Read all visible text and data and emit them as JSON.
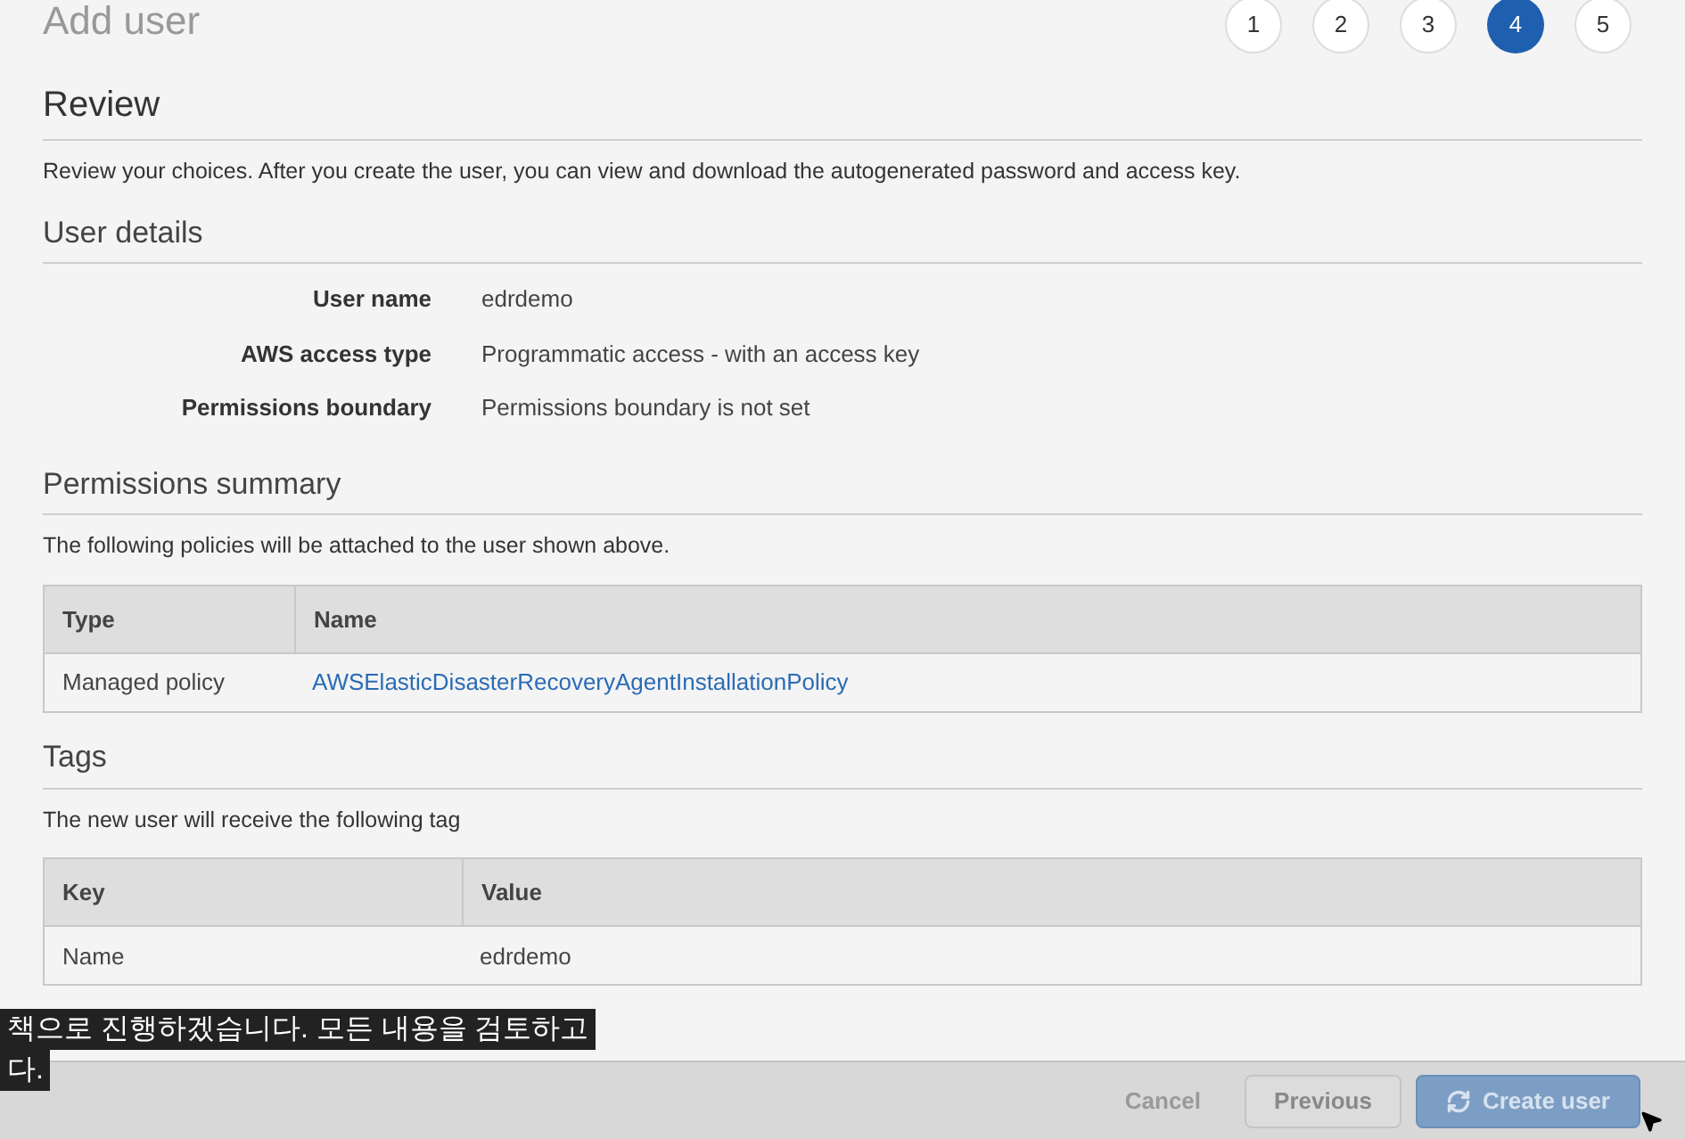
{
  "page_title": "Add user",
  "steps": [
    {
      "label": "1",
      "selected": false
    },
    {
      "label": "2",
      "selected": false
    },
    {
      "label": "3",
      "selected": false
    },
    {
      "label": "4",
      "selected": true
    },
    {
      "label": "5",
      "selected": false
    }
  ],
  "review": {
    "title": "Review",
    "description": "Review your choices. After you create the user, you can view and download the autogenerated password and access key."
  },
  "user_details": {
    "title": "User details",
    "fields": [
      {
        "label": "User name",
        "value": "edrdemo"
      },
      {
        "label": "AWS access type",
        "value": "Programmatic access - with an access key"
      },
      {
        "label": "Permissions boundary",
        "value": "Permissions boundary is not set"
      }
    ]
  },
  "permissions_summary": {
    "title": "Permissions summary",
    "description": "The following policies will be attached to the user shown above.",
    "columns": [
      "Type",
      "Name"
    ],
    "rows": [
      [
        "Managed policy",
        "AWSElasticDisasterRecoveryAgentInstallationPolicy"
      ]
    ]
  },
  "tags": {
    "title": "Tags",
    "description": "The new user will receive the following tag",
    "columns": [
      "Key",
      "Value"
    ],
    "rows": [
      [
        "Name",
        "edrdemo"
      ]
    ]
  },
  "subtitles": [
    "책으로 진행하겠습니다. 모든 내용을 검토하고",
    "다."
  ],
  "footer_buttons": [
    {
      "kind": "link",
      "label": "Cancel"
    },
    {
      "kind": "secondary",
      "label": "Previous"
    },
    {
      "kind": "primary-loading",
      "label": "Create user"
    }
  ]
}
